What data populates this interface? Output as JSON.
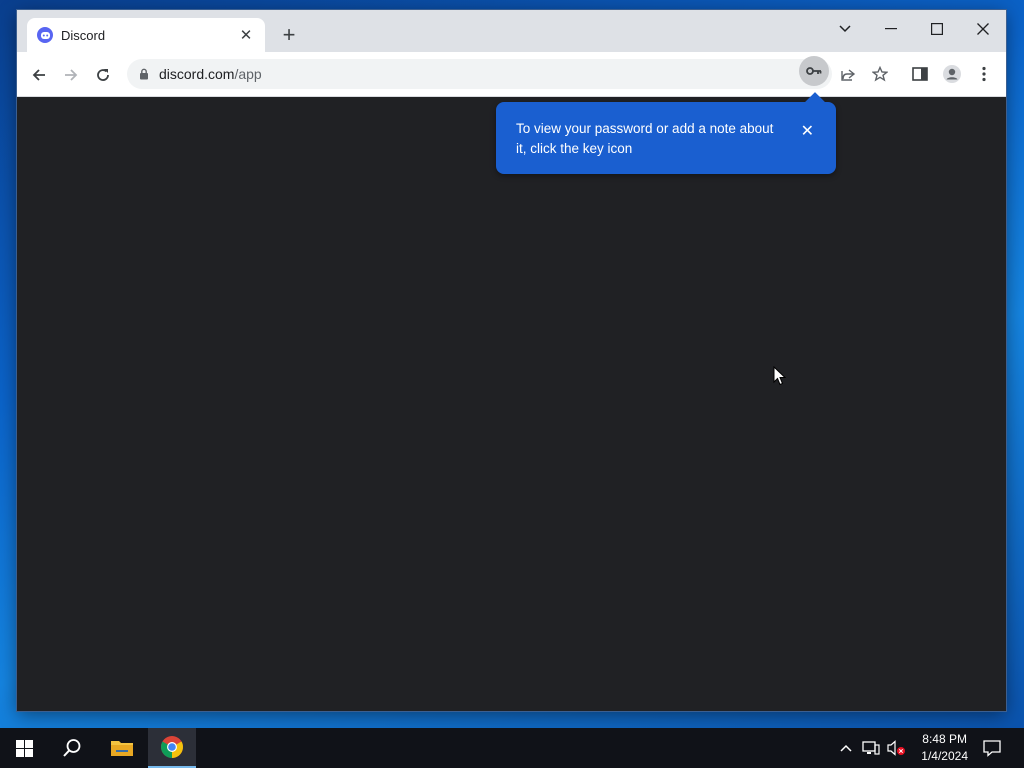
{
  "tab": {
    "title": "Discord"
  },
  "omnibox": {
    "domain": "discord.com",
    "path": "/app"
  },
  "bubble": {
    "text": "To view your password or add a note about it, click the key icon"
  },
  "taskbar": {
    "time": "8:48 PM",
    "date": "1/4/2024"
  },
  "colors": {
    "accent": "#1a5fd0",
    "content_bg": "#202124",
    "discord": "#5865f2"
  }
}
